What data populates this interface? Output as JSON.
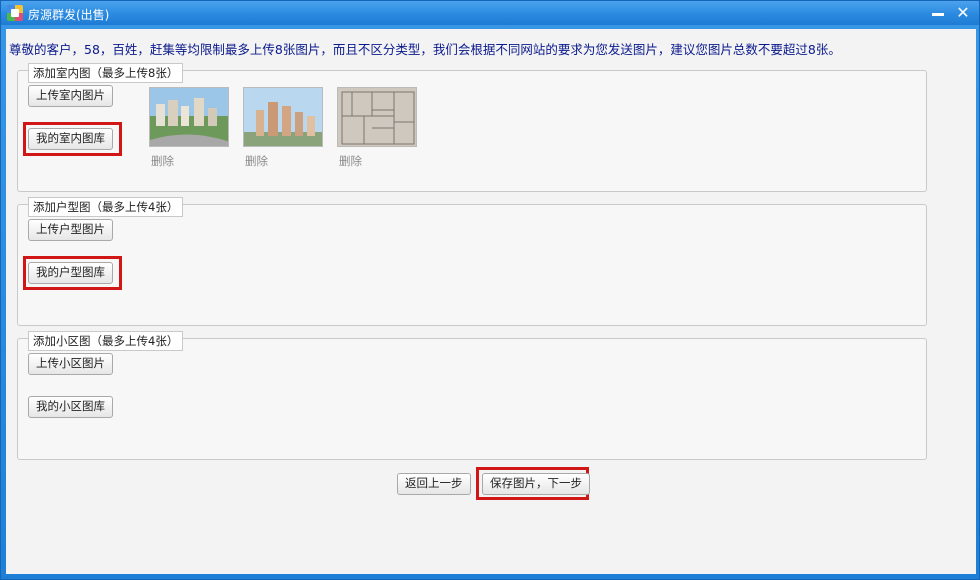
{
  "window": {
    "title": "房源群发(出售)"
  },
  "notice": "尊敬的客户，58，百姓，赶集等均限制最多上传8张图片，而且不区分类型，我们会根据不同网站的要求为您发送图片，建议您图片总数不要超过8张。",
  "sections": {
    "indoor": {
      "legend": "添加室内图（最多上传8张）",
      "upload": "上传室内图片",
      "library": "我的室内图库"
    },
    "floorplan": {
      "legend": "添加户型图（最多上传4张）",
      "upload": "上传户型图片",
      "library": "我的户型图库"
    },
    "community": {
      "legend": "添加小区图（最多上传4张）",
      "upload": "上传小区图片",
      "library": "我的小区图库"
    }
  },
  "thumbnails": [
    {
      "delete": "删除"
    },
    {
      "delete": "删除"
    },
    {
      "delete": "删除"
    }
  ],
  "footer": {
    "back": "返回上一步",
    "save_next": "保存图片，下一步"
  },
  "colors": {
    "highlight": "#d11616",
    "notice_text": "#0b1a8c",
    "titlebar": "#2a8ae0"
  },
  "icons": {
    "app": "app-logo-icon",
    "minimize": "minimize-icon",
    "close": "close-icon"
  }
}
